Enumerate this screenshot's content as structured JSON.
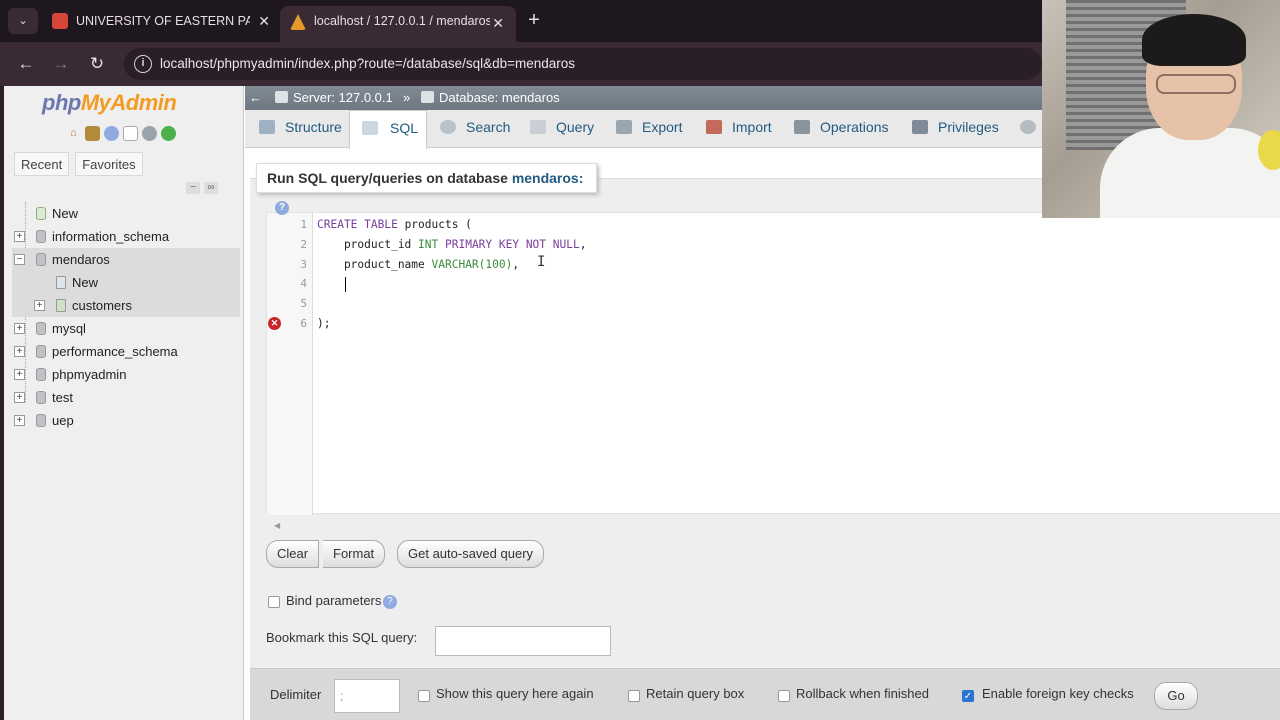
{
  "browser": {
    "tabs": [
      {
        "title": "UNIVERSITY OF EASTERN PANG",
        "close": "✕"
      },
      {
        "title": "localhost / 127.0.0.1 / mendaros",
        "close": "✕"
      }
    ],
    "new_tab": "+",
    "menu_icon": "⌄",
    "url": "localhost/phpmyadmin/index.php?route=/database/sql&db=mendaros"
  },
  "sidebar": {
    "logo_php": "php",
    "logo_my": "MyAdmin",
    "tabs": [
      "Recent",
      "Favorites"
    ],
    "tree": [
      {
        "label": "New"
      },
      {
        "label": "information_schema"
      },
      {
        "label": "mendaros"
      },
      {
        "label": "New"
      },
      {
        "label": "customers"
      },
      {
        "label": "mysql"
      },
      {
        "label": "performance_schema"
      },
      {
        "label": "phpmyadmin"
      },
      {
        "label": "test"
      },
      {
        "label": "uep"
      }
    ]
  },
  "breadcrumb": {
    "server": "Server: 127.0.0.1",
    "separator": "»",
    "database": "Database: mendaros"
  },
  "main_tabs": [
    "Structure",
    "SQL",
    "Search",
    "Query",
    "Export",
    "Import",
    "Operations",
    "Privileges"
  ],
  "query_legend": {
    "prefix": "Run SQL query/queries on database",
    "db": "mendaros:"
  },
  "editor": {
    "line_numbers": [
      "1",
      "2",
      "3",
      "4",
      "5",
      "6"
    ],
    "lines": {
      "l1_kw": "CREATE TABLE",
      "l1_rest": " products (",
      "l2_name": "    product_id ",
      "l2_type": "INT",
      "l2_kw": " PRIMARY KEY NOT NULL",
      "l2_end": ",",
      "l3_name": "    product_name ",
      "l3_type": "VARCHAR(100)",
      "l3_end": ",",
      "l6": ");"
    },
    "error_line": "6"
  },
  "buttons": {
    "clear": "Clear",
    "format": "Format",
    "autosaved": "Get auto-saved query",
    "go": "Go"
  },
  "options": {
    "bind_parameters": "Bind parameters",
    "bookmark": "Bookmark this SQL query:",
    "delimiter": "Delimiter",
    "delimiter_value": ";",
    "show_query": "Show this query here again",
    "retain_box": "Retain query box",
    "rollback": "Rollback when finished",
    "foreign_keys": "Enable foreign key checks"
  }
}
